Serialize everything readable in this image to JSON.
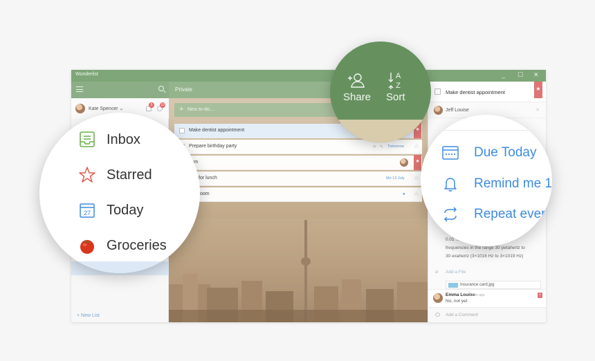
{
  "window": {
    "app_title": "Wunderlist",
    "minimize": "_",
    "maximize": "☐",
    "close": "✕"
  },
  "sidebar": {
    "user_name": "Kate Spencer ⌄",
    "notif_count": "5",
    "activity_count": "10",
    "new_list": "+  New List"
  },
  "main": {
    "list_title": "Private",
    "add_placeholder": "New to-do...",
    "tasks": [
      {
        "text": "Make dentist appointment",
        "due": "",
        "flagged": true
      },
      {
        "text": "Prepare birthday party",
        "due": "Tomorrow",
        "flagged": false
      },
      {
        "text": "Tom",
        "due": "",
        "flagged": true
      },
      {
        "text": "Erik for lunch",
        "due": "Mo 13 July",
        "flagged": false
      },
      {
        "text": "bathroom",
        "due": "",
        "flagged": false
      }
    ]
  },
  "detail": {
    "title": "Make dentist appointment",
    "assignee": "Jeff Louise",
    "note_lines": [
      "0.01 ...............................ng to",
      "frequencies in the range 30 petahertz to",
      "30 exahertz (3×1016 Hz to 3×1019 Hz)"
    ],
    "add_file": "Add a File",
    "file_name": "Insurance card.jpg",
    "comment_author": "Emma Louise",
    "comment_time": "5min ago",
    "comment_text": "No, not yet",
    "add_comment": "Add a Comment"
  },
  "zoom_left": {
    "items": [
      {
        "label": "Inbox",
        "icon": "inbox-icon",
        "color": "#6ab04c"
      },
      {
        "label": "Starred",
        "icon": "star-icon",
        "color": "#e05a4f"
      },
      {
        "label": "Today",
        "icon": "calendar-today-icon",
        "color": "#3d8be0",
        "day": "27"
      },
      {
        "label": "Groceries",
        "icon": "tomato-icon",
        "color": "#d9361e"
      }
    ]
  },
  "zoom_top": {
    "share": "Share",
    "sort": "Sort",
    "sort_glyph_a": "A",
    "sort_glyph_z": "Z"
  },
  "zoom_right": {
    "items": [
      {
        "label": "Due Today",
        "icon": "due-calendar-icon"
      },
      {
        "label": "Remind me 1",
        "icon": "bell-icon"
      },
      {
        "label": "Repeat ever",
        "icon": "repeat-icon"
      }
    ]
  },
  "colors": {
    "accent_green": "#7ea678",
    "accent_blue": "#3d8be0",
    "flag_red": "#e07474"
  }
}
